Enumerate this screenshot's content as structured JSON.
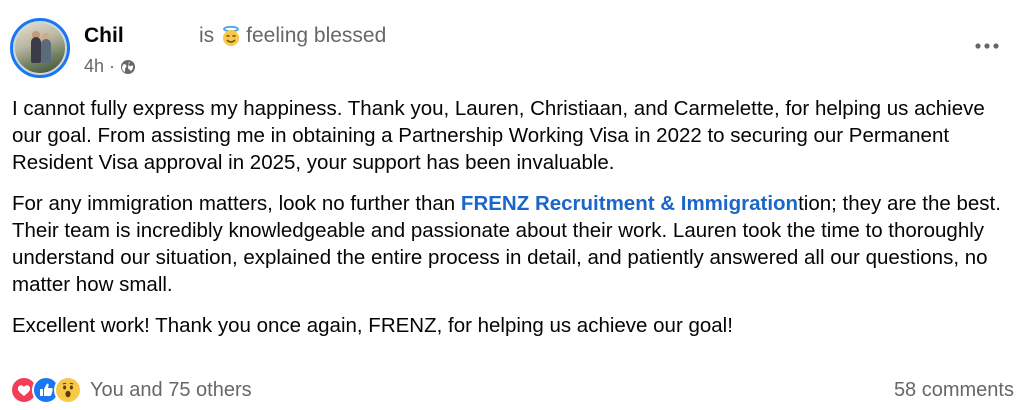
{
  "post": {
    "author": "Chil",
    "feeling_prefix": "is",
    "feeling": "feeling blessed",
    "feeling_icon": "smiling-face-with-halo-icon",
    "time": "4h",
    "separator": "·",
    "privacy_icon": "globe-icon",
    "paragraphs": {
      "p1": "I cannot fully express my happiness. Thank you, Lauren, Christiaan, and Carmelette, for helping us achieve our goal. From assisting me in obtaining a Partnership Working Visa in 2022 to securing our Permanent Resident Visa approval in 2025, your support has been invaluable.",
      "p2_before": "For any immigration matters, look no further than ",
      "p2_link": "FRENZ Recruitment & Immigration",
      "p2_after": "tion; they are the best. Their team is incredibly knowledgeable and passionate about their work. Lauren took the time to thoroughly understand our situation, explained the entire process in detail, and patiently answered all our questions, no matter how small.",
      "p3": "Excellent work! Thank you once again, FRENZ, for helping us achieve our goal!"
    }
  },
  "footer": {
    "reactions_label": "You and 75 others",
    "reaction_icons": [
      "love-reaction-icon",
      "like-reaction-icon",
      "wow-reaction-icon"
    ],
    "comments_label": "58 comments"
  },
  "colors": {
    "link": "#1b66c9",
    "secondary_text": "#65676b",
    "avatar_ring": "#1877f2"
  }
}
